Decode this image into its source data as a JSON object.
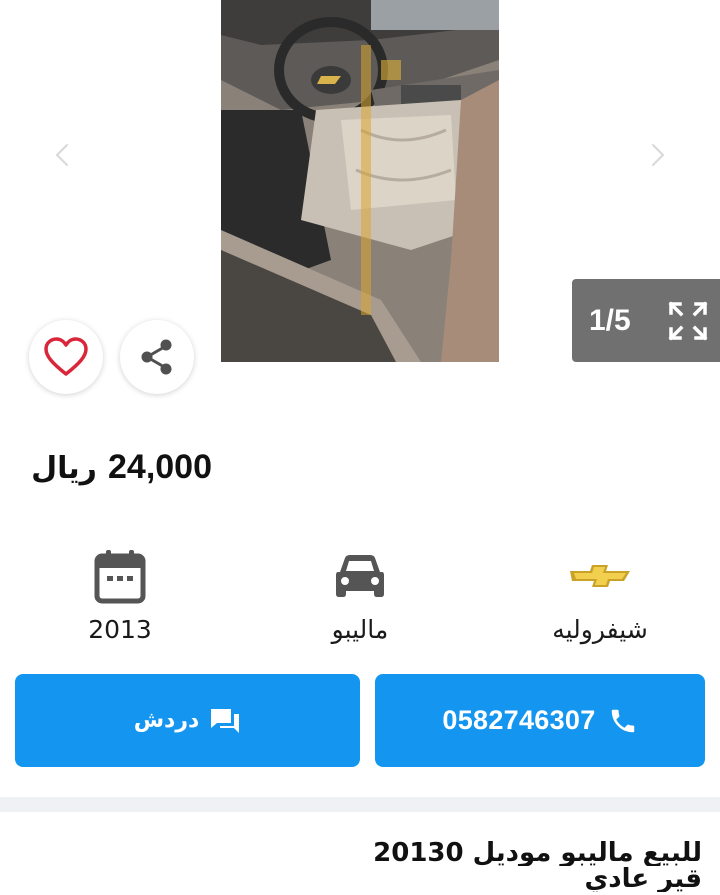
{
  "gallery": {
    "counter": "1/5",
    "current": 1,
    "total": 5
  },
  "listing": {
    "price": "24,000",
    "currency": "ريال",
    "title_line1": "للبيع ماليبو موديل 20130",
    "title_line2": "قير عادي"
  },
  "specs": [
    {
      "icon": "calendar-icon",
      "label": "2013"
    },
    {
      "icon": "car-icon",
      "label": "ماليبو"
    },
    {
      "icon": "chevrolet-logo",
      "label": "شيفروليه"
    }
  ],
  "actions": {
    "chat_label": "دردش",
    "call_label": "0582746307"
  },
  "colors": {
    "accent": "#1496f0",
    "heart": "#d9263a",
    "counter_bg": "#707070"
  }
}
